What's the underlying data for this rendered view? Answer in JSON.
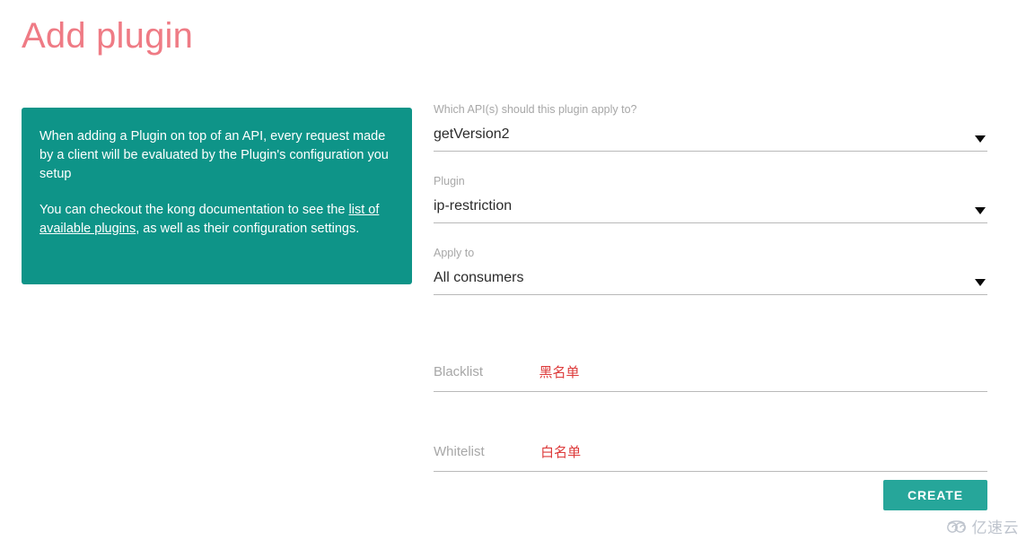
{
  "page": {
    "title": "Add plugin",
    "title_color": "#ef7b85"
  },
  "info_box": {
    "background_color": "#0e9488",
    "paragraph_1": "When adding a Plugin on top of an API, every request made by a client will be evaluated by the Plugin's configuration you setup",
    "paragraph_2_before_link": "You can checkout the kong documentation to see the ",
    "link_text": "list of available plugins",
    "paragraph_2_after_link": ", as well as their configuration settings."
  },
  "form": {
    "api_field": {
      "label": "Which API(s) should this plugin apply to?",
      "value": "getVersion2",
      "caret": "chevron-down-icon"
    },
    "plugin_field": {
      "label": "Plugin",
      "value": "ip-restriction",
      "caret": "chevron-down-icon"
    },
    "apply_to_field": {
      "label": "Apply to",
      "value": "All consumers",
      "caret": "chevron-down-icon"
    },
    "blacklist_field": {
      "label": "Blacklist",
      "placeholder": "Blacklist",
      "value": "",
      "annotation": "黑名单",
      "annotation_color": "#dd3a3a"
    },
    "whitelist_field": {
      "label": "Whitelist",
      "placeholder": "Whitelist",
      "value": "",
      "annotation": "白名单",
      "annotation_color": "#dd3a3a"
    }
  },
  "actions": {
    "create_label": "CREATE",
    "create_color": "#26a69a"
  },
  "watermark": {
    "text": "亿速云",
    "logo": "cloud-swirl-icon",
    "color": "#b9bfc9"
  }
}
